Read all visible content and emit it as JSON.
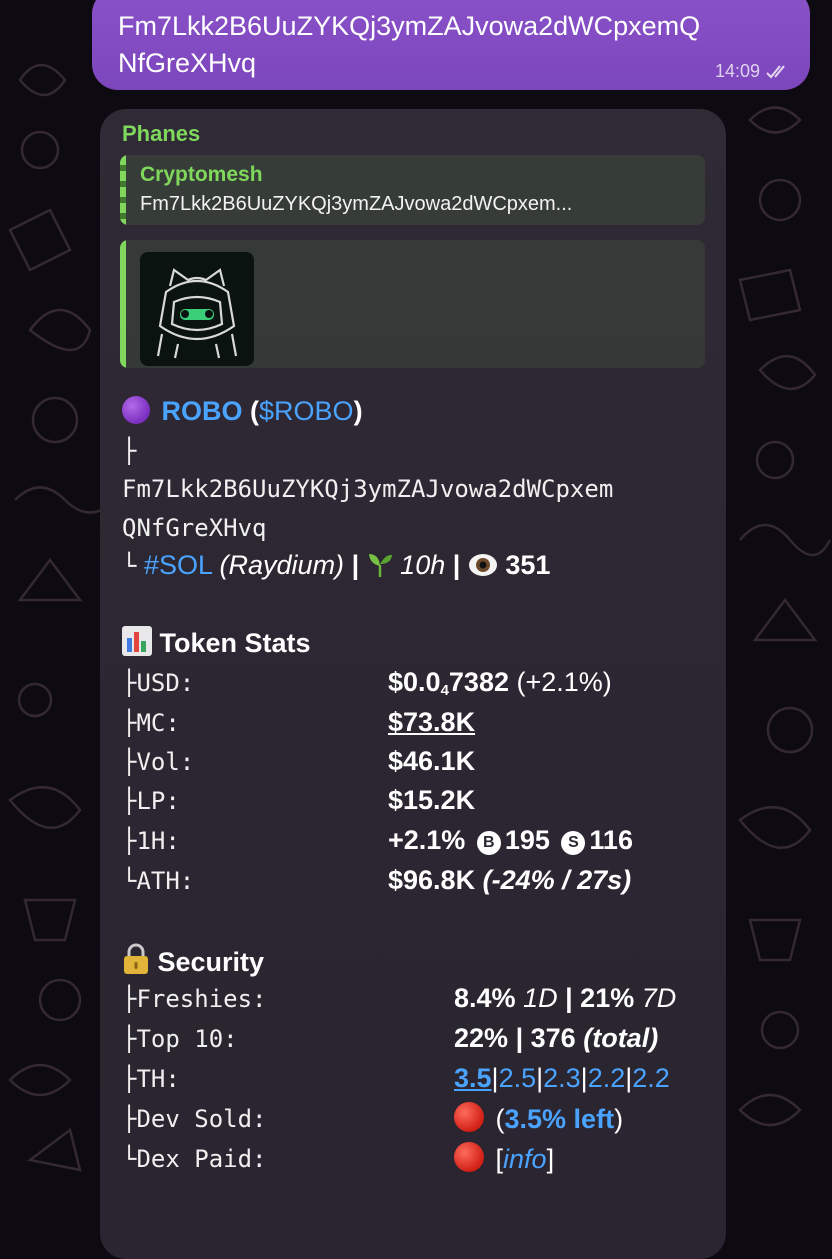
{
  "outgoing": {
    "text": "Fm7Lkk2B6UuZYKQj3ymZAJvowa2dWCpxemQNfGreXHvq",
    "time": "14:09"
  },
  "incoming": {
    "sender": "Phanes",
    "reply": {
      "name": "Cryptomesh",
      "text": "Fm7Lkk2B6UuZYKQj3ymZAJvowa2dWCpxem..."
    },
    "token": {
      "name": "ROBO",
      "open_paren": "(",
      "symbol": "$ROBO",
      "close_paren": ")",
      "address_line1": "Fm7Lkk2B6UuZYKQj3ymZAJvowa2dWCpxem",
      "address_line2": "QNfGreXHvq",
      "chain": "#SOL",
      "dex": "(Raydium)",
      "sep1": "|",
      "age": "10h",
      "sep2": "|",
      "views": "351"
    },
    "stats": {
      "header": "Token Stats",
      "rows": [
        {
          "label": "USD:",
          "value_a": "$0.0",
          "value_sub": "4",
          "value_b": "7382",
          "extra": " (+2.1%)"
        },
        {
          "label": "MC:",
          "value": "$73.8K"
        },
        {
          "label": "Vol:",
          "value": "$46.1K"
        },
        {
          "label": "LP:",
          "value": "$15.2K"
        },
        {
          "label": "1H:",
          "value": "+2.1%",
          "buys_icon": "B",
          "buys": "195",
          "sells_icon": "S",
          "sells": "116"
        },
        {
          "label": "ATH:",
          "value": "$96.8K",
          "extra": "(-24% / 27s)"
        }
      ]
    },
    "security": {
      "header": "Security",
      "rows": [
        {
          "label": "Freshies:",
          "v1": "8.4%",
          "v1i": "1D",
          "sep": "|",
          "v2": "21%",
          "v2i": "7D"
        },
        {
          "label": "Top 10:",
          "v1": "22%",
          "sep": "|",
          "v2": "376",
          "v2i": "(total)"
        },
        {
          "label": "TH:",
          "values": [
            "3.5",
            "2.5",
            "2.3",
            "2.2",
            "2.2"
          ],
          "sep": "|"
        },
        {
          "label": "Dev Sold:",
          "open": "(",
          "link": "3.5% left",
          "close": ")"
        },
        {
          "label": "Dex Paid:",
          "open": "[",
          "link": "info",
          "close": "]"
        }
      ]
    },
    "prefixes": {
      "branch": "├",
      "end": "└"
    }
  },
  "colors": {
    "outgoing_bubble": "#8a52c8",
    "incoming_bubble": "#2f2a35",
    "sender": "#7fd85b",
    "link": "#4aa3ff",
    "status_red": "#d11f14"
  },
  "icons": {
    "token_dot": "purple-circle-icon",
    "seedling": "seedling-icon",
    "eye": "eye-icon",
    "chart": "bar-chart-icon",
    "lock": "lock-icon",
    "read": "double-check-icon"
  }
}
